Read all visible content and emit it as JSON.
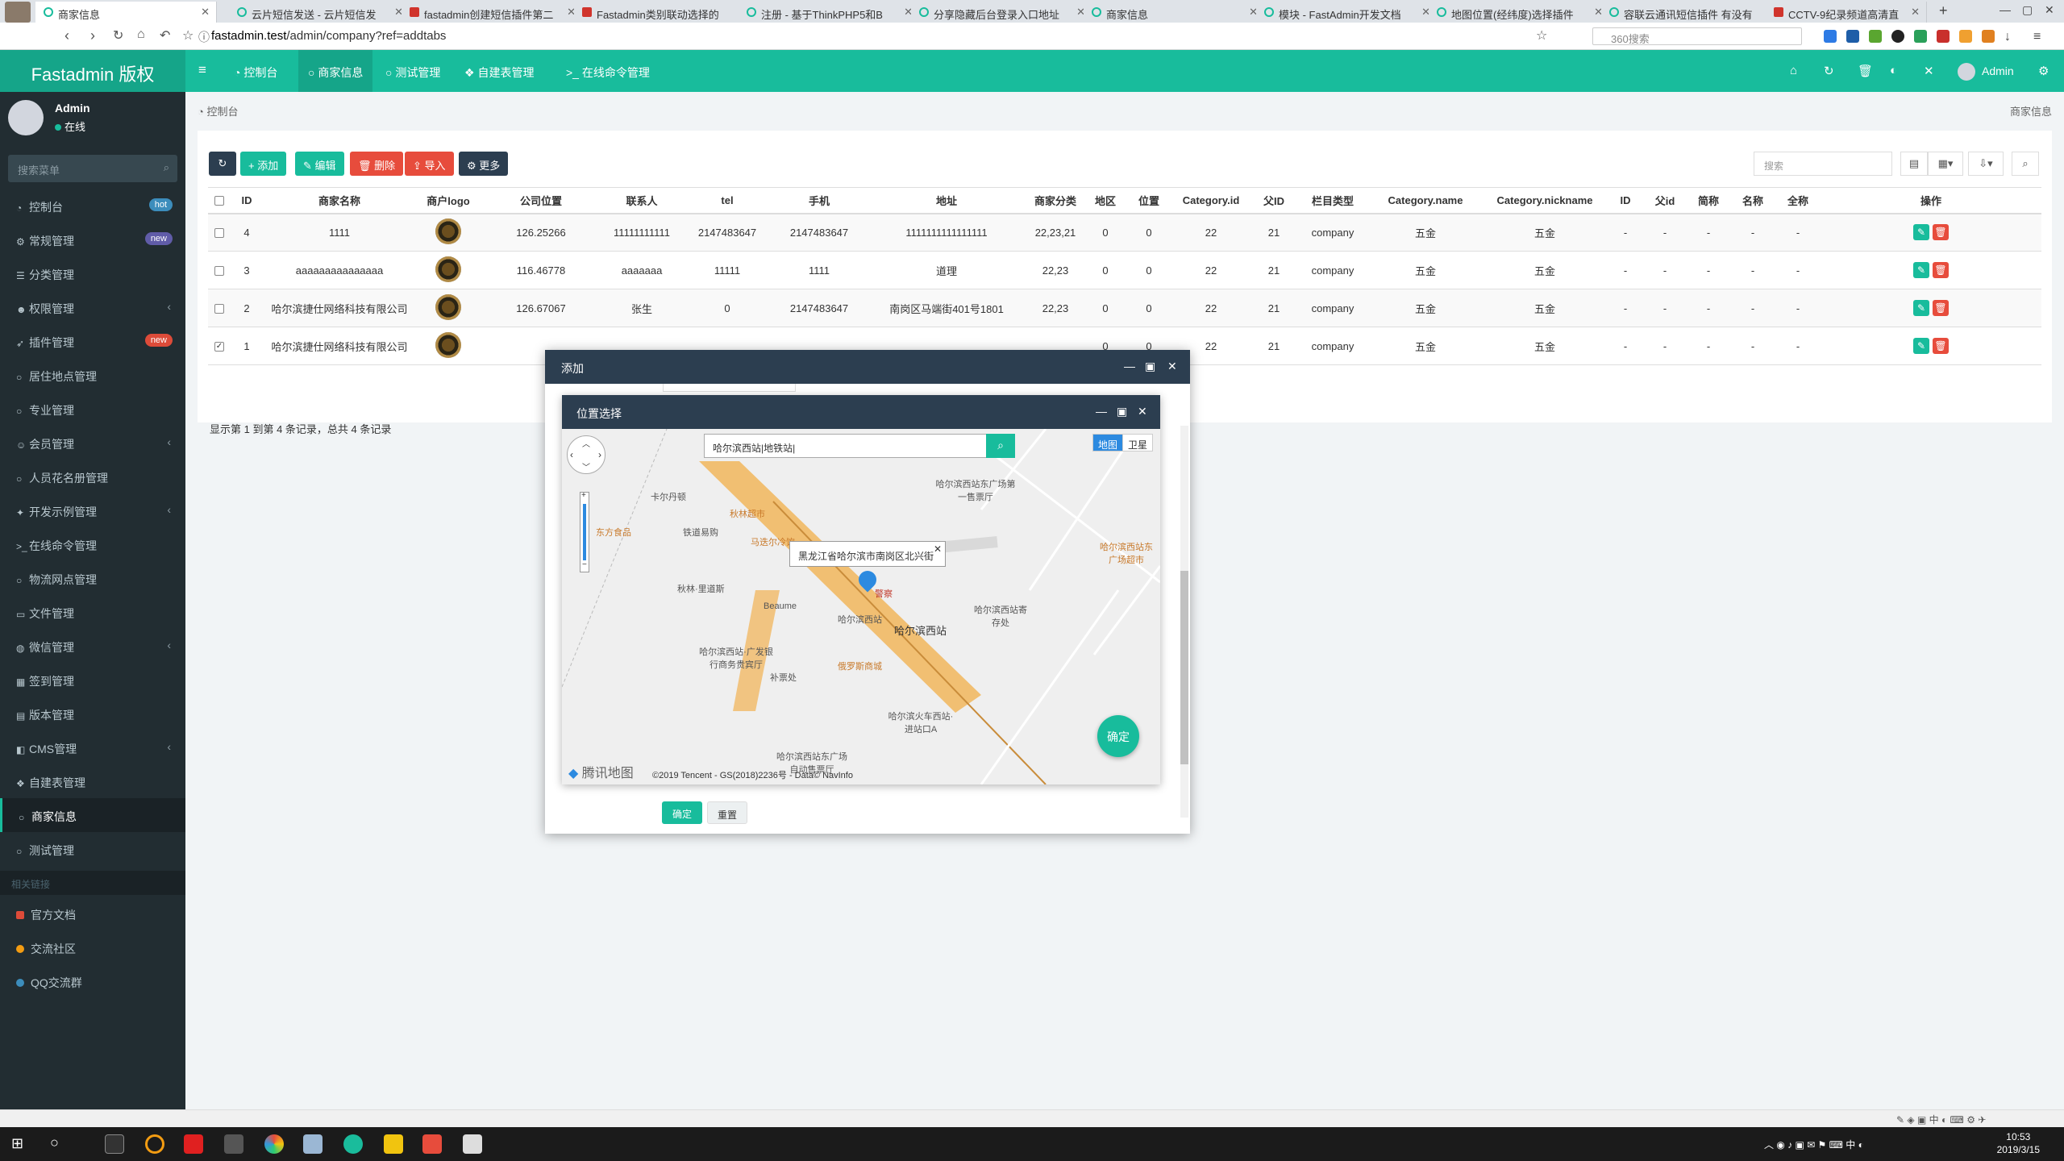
{
  "browser": {
    "tabs": [
      {
        "title": "商家信息",
        "active": true
      },
      {
        "title": "云片短信发送 - 云片短信发",
        "active": false
      },
      {
        "title": "fastadmin创建短信插件第二",
        "active": false
      },
      {
        "title": "Fastadmin类别联动选择的",
        "active": false
      },
      {
        "title": "注册 - 基于ThinkPHP5和B",
        "active": false
      },
      {
        "title": "分享隐藏后台登录入口地址",
        "active": false
      },
      {
        "title": "商家信息",
        "active": false
      },
      {
        "title": "模块 - FastAdmin开发文档",
        "active": false
      },
      {
        "title": "地图位置(经纬度)选择插件",
        "active": false
      },
      {
        "title": "容联云通讯短信插件 有没有",
        "active": false
      },
      {
        "title": "CCTV-9纪录频道高清直",
        "active": false
      }
    ],
    "url_host": "fastadmin.test",
    "url_path": "/admin/company?ref=addtabs",
    "search_placeholder": "360搜索"
  },
  "app": {
    "brand": "Fastadmin 版权",
    "topnav": [
      {
        "label": "控制台",
        "icon": "dashboard-icon"
      },
      {
        "label": "商家信息",
        "icon": "circle-icon",
        "active": true
      },
      {
        "label": "测试管理",
        "icon": "circle-icon"
      },
      {
        "label": "自建表管理",
        "icon": "cubes-icon"
      },
      {
        "label": "在线命令管理",
        "icon": "terminal-icon"
      }
    ],
    "admin_label": "Admin"
  },
  "sidebar": {
    "user": {
      "name": "Admin",
      "status": "在线"
    },
    "search_placeholder": "搜索菜单",
    "items": [
      {
        "label": "控制台",
        "badge": "hot",
        "badge_color": "#3c8dbc"
      },
      {
        "label": "常规管理",
        "badge": "new",
        "badge_color": "#605ca8"
      },
      {
        "label": "分类管理"
      },
      {
        "label": "权限管理",
        "chevron": true
      },
      {
        "label": "插件管理",
        "badge": "new",
        "badge_color": "#dd4b39"
      },
      {
        "label": "居住地点管理"
      },
      {
        "label": "专业管理"
      },
      {
        "label": "会员管理",
        "chevron": true
      },
      {
        "label": "人员花名册管理"
      },
      {
        "label": "开发示例管理",
        "chevron": true
      },
      {
        "label": "在线命令管理"
      },
      {
        "label": "物流网点管理"
      },
      {
        "label": "文件管理"
      },
      {
        "label": "微信管理",
        "chevron": true
      },
      {
        "label": "签到管理"
      },
      {
        "label": "版本管理"
      },
      {
        "label": "CMS管理",
        "chevron": true
      },
      {
        "label": "自建表管理"
      },
      {
        "label": "商家信息",
        "active": true
      },
      {
        "label": "测试管理"
      }
    ],
    "section_header": "相关链接",
    "links": [
      {
        "label": "官方文档",
        "color": "#dd4b39"
      },
      {
        "label": "交流社区",
        "color": "#f39c12"
      },
      {
        "label": "QQ交流群",
        "color": "#3c8dbc"
      }
    ]
  },
  "content": {
    "breadcrumb": "控制台",
    "breadcrumb_right": "商家信息",
    "toolbar": {
      "add": "添加",
      "edit": "编辑",
      "delete": "删除",
      "import": "导入",
      "more": "更多",
      "search_placeholder": "搜索"
    },
    "table": {
      "headers": [
        "ID",
        "商家名称",
        "商户logo",
        "公司位置",
        "联系人",
        "tel",
        "手机",
        "地址",
        "商家分类",
        "地区",
        "位置",
        "Category.id",
        "父ID",
        "栏目类型",
        "Category.name",
        "Category.nickname",
        "ID",
        "父id",
        "简称",
        "名称",
        "全称",
        "操作"
      ],
      "rows": [
        {
          "checked": false,
          "cells": [
            "4",
            "1111",
            "",
            "126.25266",
            "11111111111",
            "2147483647",
            "2147483647",
            "1111111111111111",
            "22,23,21",
            "0",
            "0",
            "22",
            "21",
            "company",
            "五金",
            "五金",
            "-",
            "-",
            "-",
            "-",
            "-"
          ]
        },
        {
          "checked": false,
          "cells": [
            "3",
            "aaaaaaaaaaaaaaa",
            "",
            "116.46778",
            "aaaaaaa",
            "11111",
            "1111",
            "道理",
            "22,23",
            "0",
            "0",
            "22",
            "21",
            "company",
            "五金",
            "五金",
            "-",
            "-",
            "-",
            "-",
            "-"
          ]
        },
        {
          "checked": false,
          "cells": [
            "2",
            "哈尔滨捷仕网络科技有限公司",
            "",
            "126.67067",
            "张生",
            "0",
            "2147483647",
            "南岗区马端街401号1801",
            "22,23",
            "0",
            "0",
            "22",
            "21",
            "company",
            "五金",
            "五金",
            "-",
            "-",
            "-",
            "-",
            "-"
          ]
        },
        {
          "checked": true,
          "cells": [
            "1",
            "哈尔滨捷仕网络科技有限公司",
            "",
            "",
            "",
            "",
            "",
            "",
            "",
            "0",
            "0",
            "22",
            "21",
            "company",
            "五金",
            "五金",
            "-",
            "-",
            "-",
            "-",
            "-"
          ]
        }
      ]
    },
    "page_info": "显示第 1 到第 4 条记录，总共 4 条记录"
  },
  "dialog_add": {
    "title": "添加",
    "ok": "确定",
    "reset": "重置"
  },
  "dialog_location": {
    "title": "位置选择",
    "search_value": "哈尔滨西站|地铁站|",
    "map_type_map": "地图",
    "map_type_satellite": "卫星",
    "info_window": "黑龙江省哈尔滨市南岗区北兴街",
    "confirm": "确定",
    "copyright": "©2019 Tencent - GS(2018)2236号 - Data© NavInfo",
    "provider": "腾讯地图",
    "pois": [
      "卡尔丹顿",
      "哈尔滨西站东广场第一售票厅",
      "秋林超市",
      "东方食品",
      "铁道易购",
      "马迭尔冷饮",
      "秋林·里道斯",
      "Beaume",
      "哈尔滨西站",
      "哈尔滨西站",
      "警察",
      "哈尔滨西站寄存处",
      "哈尔滨西站东广场超市",
      "哈尔滨西站·广发银行商务贵宾厅",
      "俄罗斯商城",
      "补票处",
      "哈尔滨火车西站·进站口A",
      "哈尔滨西站东广场自动售票厅"
    ]
  },
  "taskbar": {
    "time": "10:53",
    "date": "2019/3/15"
  }
}
